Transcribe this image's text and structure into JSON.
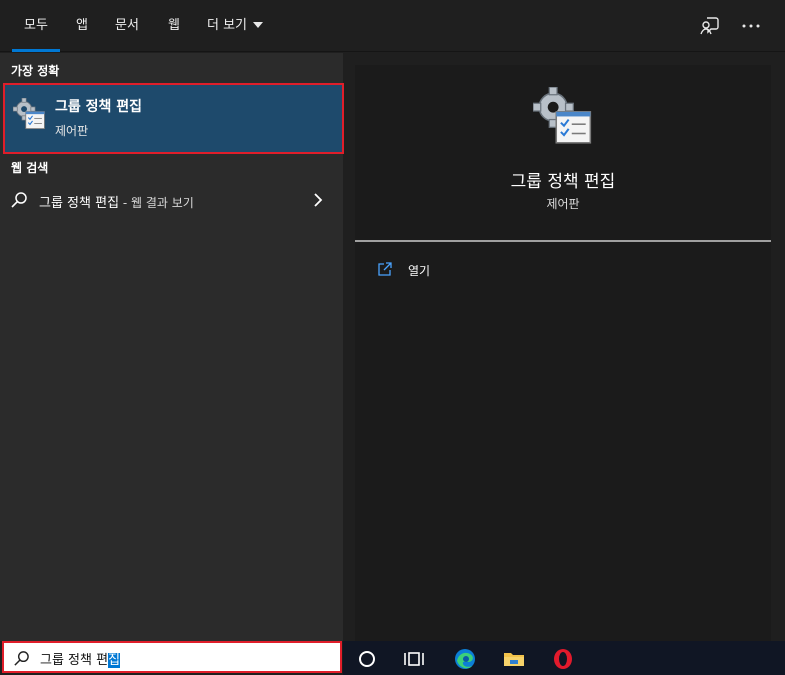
{
  "tabs": [
    {
      "label": "모두",
      "active": true
    },
    {
      "label": "앱"
    },
    {
      "label": "문서"
    },
    {
      "label": "웹"
    },
    {
      "label": "더 보기"
    }
  ],
  "header_icons": [
    "feedback-icon",
    "more-options-icon"
  ],
  "best_match": {
    "section_label": "가장 정확",
    "title": "그룹 정책 편집",
    "subtitle": "제어판",
    "icon": "group-policy-icon"
  },
  "web_search": {
    "section_label": "웹 검색",
    "query": "그룹 정책 편집",
    "suffix": " - 웹 결과 보기"
  },
  "detail": {
    "title": "그룹 정책 편집",
    "subtitle": "제어판",
    "actions": [
      {
        "label": "열기",
        "icon": "open-icon"
      }
    ]
  },
  "search_box": {
    "value_plain": "그룹 정책 편",
    "value_selected": "집"
  },
  "taskbar": {
    "icons": [
      "cortana-icon",
      "task-view-icon",
      "edge-icon",
      "file-explorer-icon",
      "opera-icon"
    ]
  },
  "colors": {
    "accent": "#0078d4",
    "highlight_border": "#e01e2a",
    "best_match_bg": "#1e4a6c"
  }
}
